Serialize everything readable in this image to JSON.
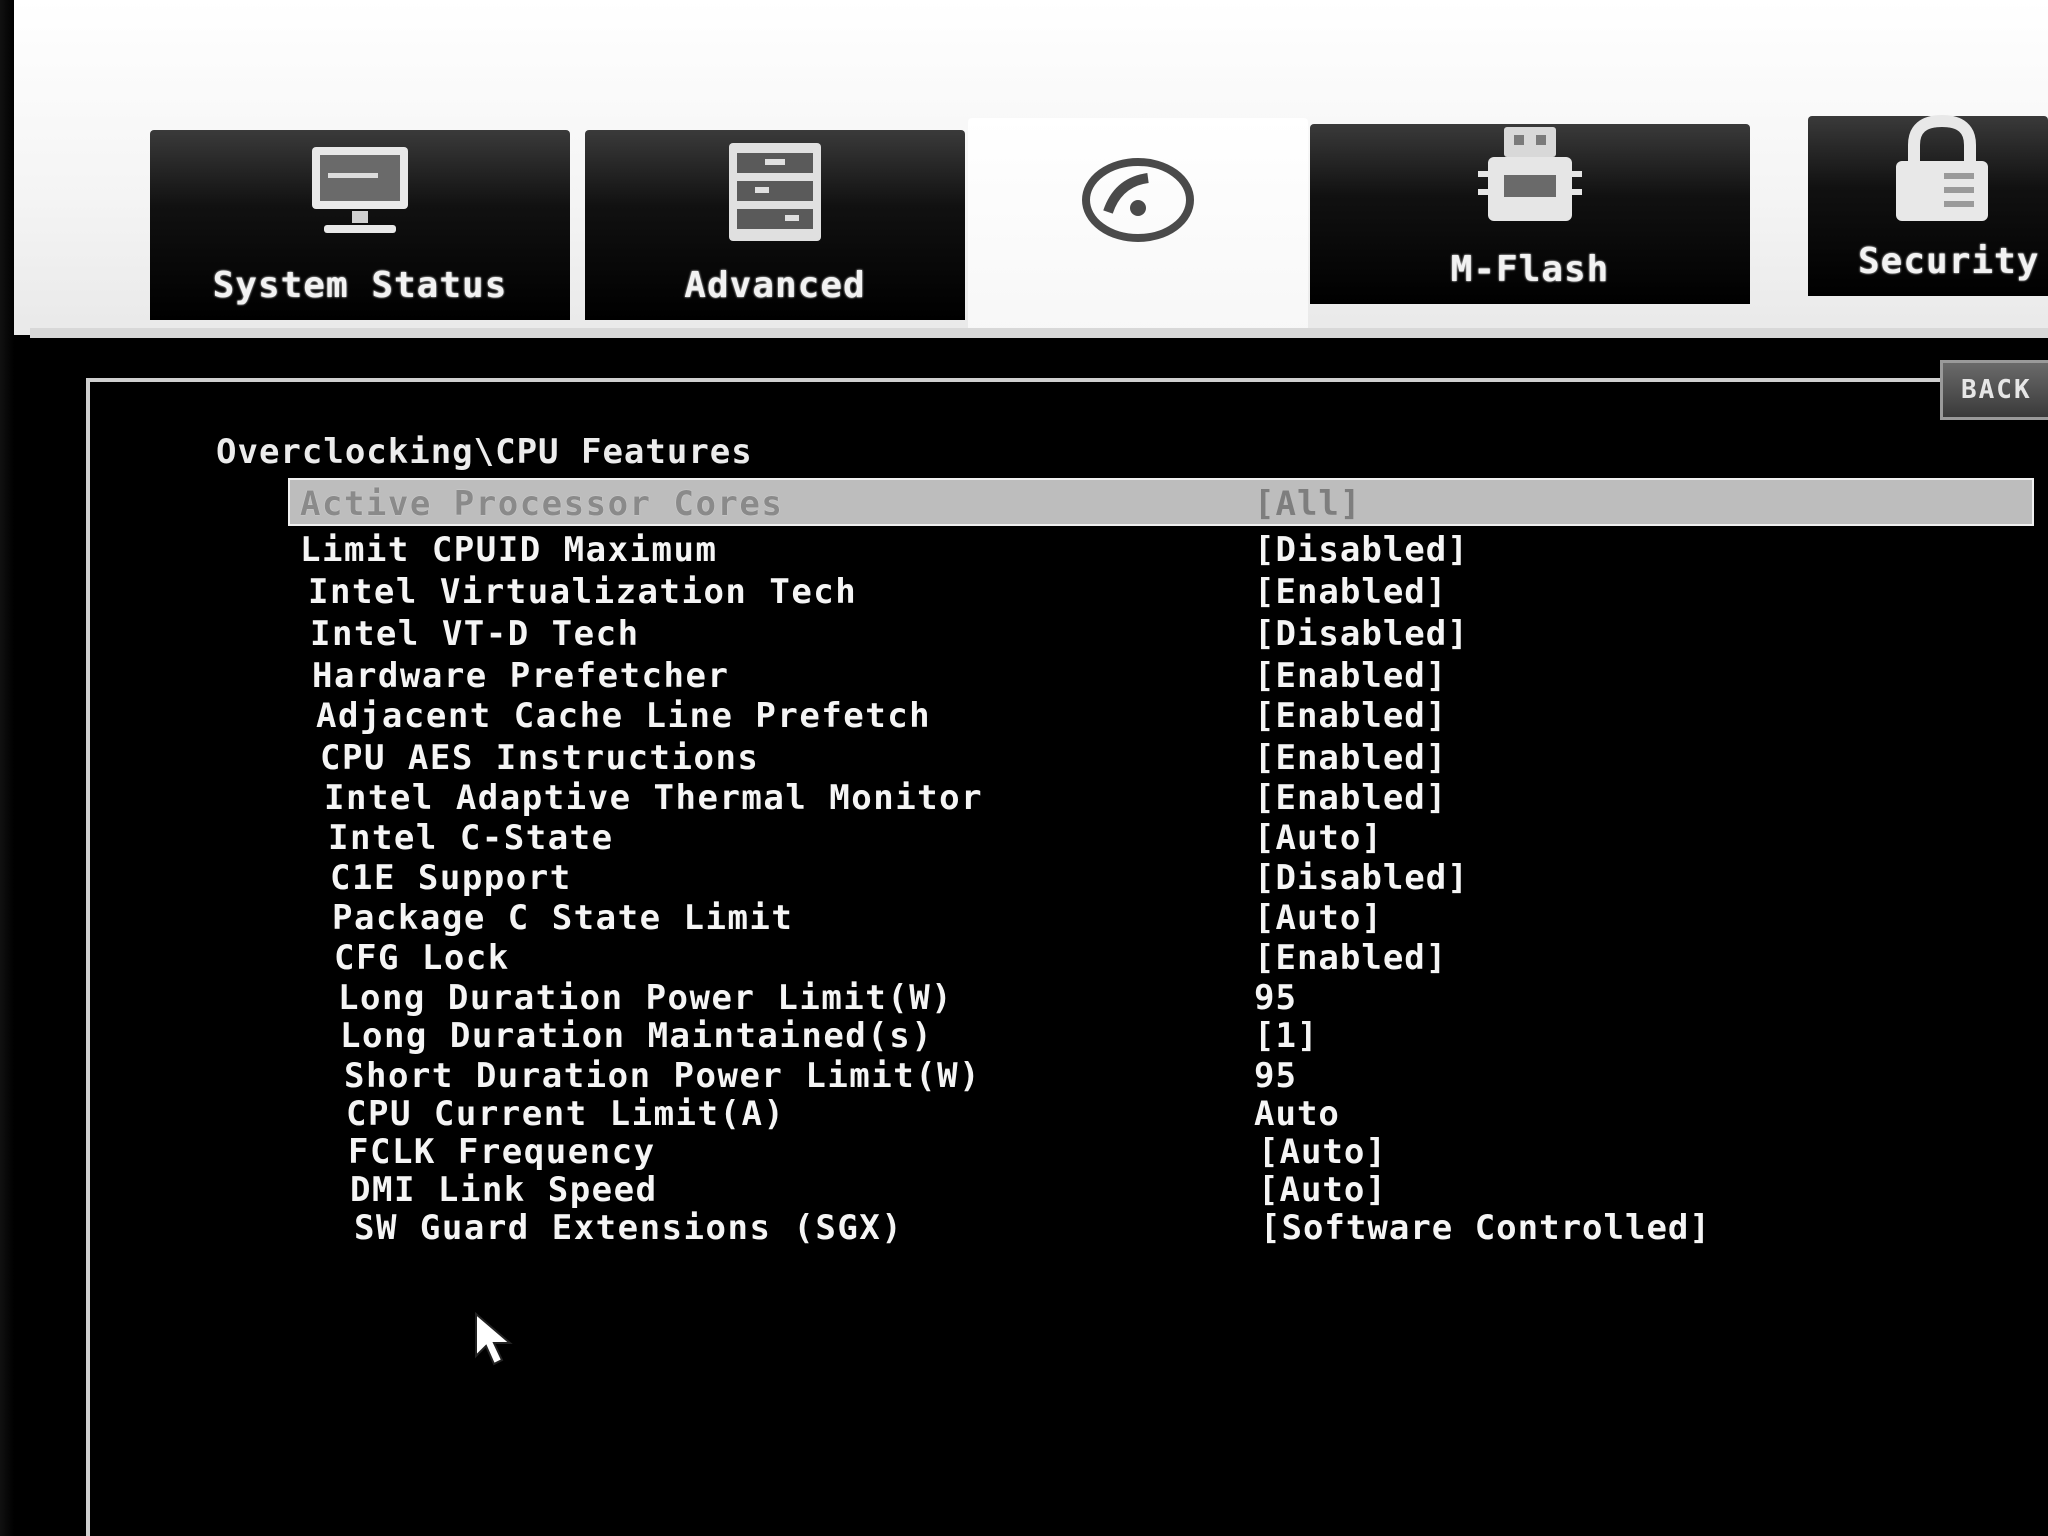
{
  "tabs": [
    {
      "label": "System Status",
      "icon": "monitor-icon",
      "active": false
    },
    {
      "label": "Advanced",
      "icon": "cabinet-icon",
      "active": false
    },
    {
      "label": "",
      "icon": "speedometer-icon",
      "active": true
    },
    {
      "label": "M-Flash",
      "icon": "flash-drive-icon",
      "active": false
    },
    {
      "label": "Security",
      "icon": "lock-icon",
      "active": false
    }
  ],
  "back_button": {
    "label": "BACK"
  },
  "breadcrumb": "Overclocking\\CPU Features",
  "settings": [
    {
      "label": "Active Processor Cores",
      "value": "[All]"
    },
    {
      "label": "Limit CPUID Maximum",
      "value": "[Disabled]"
    },
    {
      "label": "Intel Virtualization Tech",
      "value": "[Enabled]"
    },
    {
      "label": "Intel VT-D Tech",
      "value": "[Disabled]"
    },
    {
      "label": "Hardware Prefetcher",
      "value": "[Enabled]"
    },
    {
      "label": "Adjacent Cache Line Prefetch",
      "value": "[Enabled]"
    },
    {
      "label": "CPU AES Instructions",
      "value": "[Enabled]"
    },
    {
      "label": "Intel Adaptive Thermal Monitor",
      "value": "[Enabled]"
    },
    {
      "label": "Intel C-State",
      "value": "[Auto]"
    },
    {
      "label": "C1E Support",
      "value": "[Disabled]"
    },
    {
      "label": "Package C State Limit",
      "value": "[Auto]"
    },
    {
      "label": "CFG Lock",
      "value": "[Enabled]"
    },
    {
      "label": "Long Duration Power Limit(W)",
      "value": "95"
    },
    {
      "label": "Long Duration Maintained(s)",
      "value": "[1]"
    },
    {
      "label": "Short Duration Power Limit(W)",
      "value": "95"
    },
    {
      "label": "CPU Current Limit(A)",
      "value": "Auto"
    },
    {
      "label": "FCLK Frequency",
      "value": "[Auto]"
    },
    {
      "label": "DMI Link Speed",
      "value": "[Auto]"
    },
    {
      "label": "SW Guard Extensions (SGX)",
      "value": "[Software Controlled]"
    }
  ],
  "colors": {
    "background": "#000000",
    "text": "#f5f5f5",
    "highlight": "#bdbdbd",
    "header": "#ffffff"
  }
}
